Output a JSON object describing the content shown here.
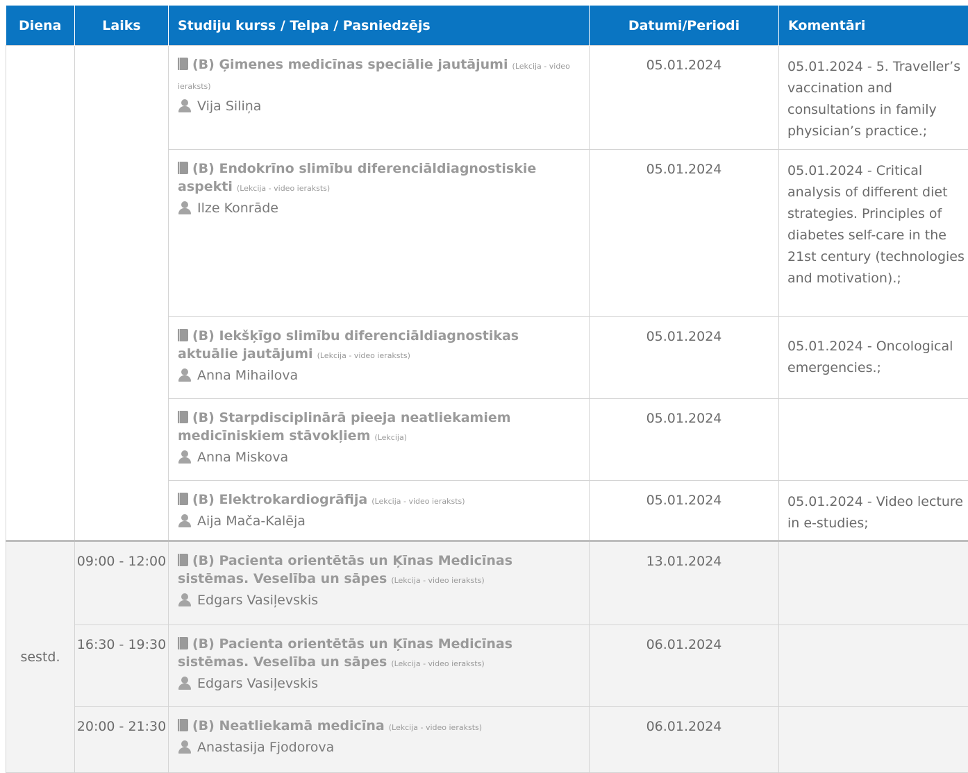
{
  "headers": {
    "day": "Diena",
    "time": "Laiks",
    "course": "Studiju kurss / Telpa / Pasniedzējs",
    "dates": "Datumi/Periodi",
    "comments": "Komentāri"
  },
  "colors": {
    "header_bg": "#0a75c2",
    "header_text": "#ffffff",
    "grey_row": "#f3f3f3"
  },
  "section1": {
    "rows": [
      {
        "course_title": "(B) Ģimenes medicīnas speciālie jautājumi",
        "course_type": "(Lekcija - video ieraksts)",
        "teacher": "Vija Siliņa",
        "date": "05.01.2024",
        "comment": "05.01.2024 - 5. Traveller’s vaccination and consultations in family physician’s practice.;"
      },
      {
        "course_title": "(B) Endokrīno slimību diferenciāldiagnostiskie aspekti",
        "course_type": "(Lekcija - video ieraksts)",
        "teacher": "Ilze Konrāde",
        "date": "05.01.2024",
        "comment": "05.01.2024 - Critical analysis of different diet strategies. Principles of diabetes self-care in the 21st century (technologies and motivation).;"
      },
      {
        "course_title": "(B) Iekšķīgo slimību diferenciāldiagnostikas aktuālie jautājumi",
        "course_type": "(Lekcija - video ieraksts)",
        "teacher": "Anna Mihailova",
        "date": "05.01.2024",
        "comment": "05.01.2024 - Oncological emergencies.;"
      },
      {
        "course_title": "(B) Starpdisciplinārā pieeja neatliekamiem medicīniskiem stāvokļiem",
        "course_type": "(Lekcija)",
        "teacher": "Anna Miskova",
        "date": "05.01.2024",
        "comment": ""
      },
      {
        "course_title": "(B) Elektrokardiogrāfija",
        "course_type": "(Lekcija - video ieraksts)",
        "teacher": "Aija Mača-Kalēja",
        "date": "05.01.2024",
        "comment": "05.01.2024 - Video lecture in e-studies;"
      }
    ]
  },
  "section2": {
    "day": "sestd.",
    "rows": [
      {
        "time": "09:00 - 12:00",
        "course_title": "(B) Pacienta orientētās un Ķīnas Medicīnas sistēmas. Veselība un sāpes",
        "course_type": "(Lekcija - video ieraksts)",
        "teacher": "Edgars Vasiļevskis",
        "date": "13.01.2024",
        "comment": ""
      },
      {
        "time": "16:30 - 19:30",
        "course_title": "(B) Pacienta orientētās un Ķīnas Medicīnas sistēmas. Veselība un sāpes",
        "course_type": "(Lekcija - video ieraksts)",
        "teacher": "Edgars Vasiļevskis",
        "date": "06.01.2024",
        "comment": ""
      },
      {
        "time": "20:00 - 21:30",
        "course_title": "(B) Neatliekamā medicīna",
        "course_type": "(Lekcija - video ieraksts)",
        "teacher": "Anastasija Fjodorova",
        "date": "06.01.2024",
        "comment": ""
      }
    ]
  }
}
